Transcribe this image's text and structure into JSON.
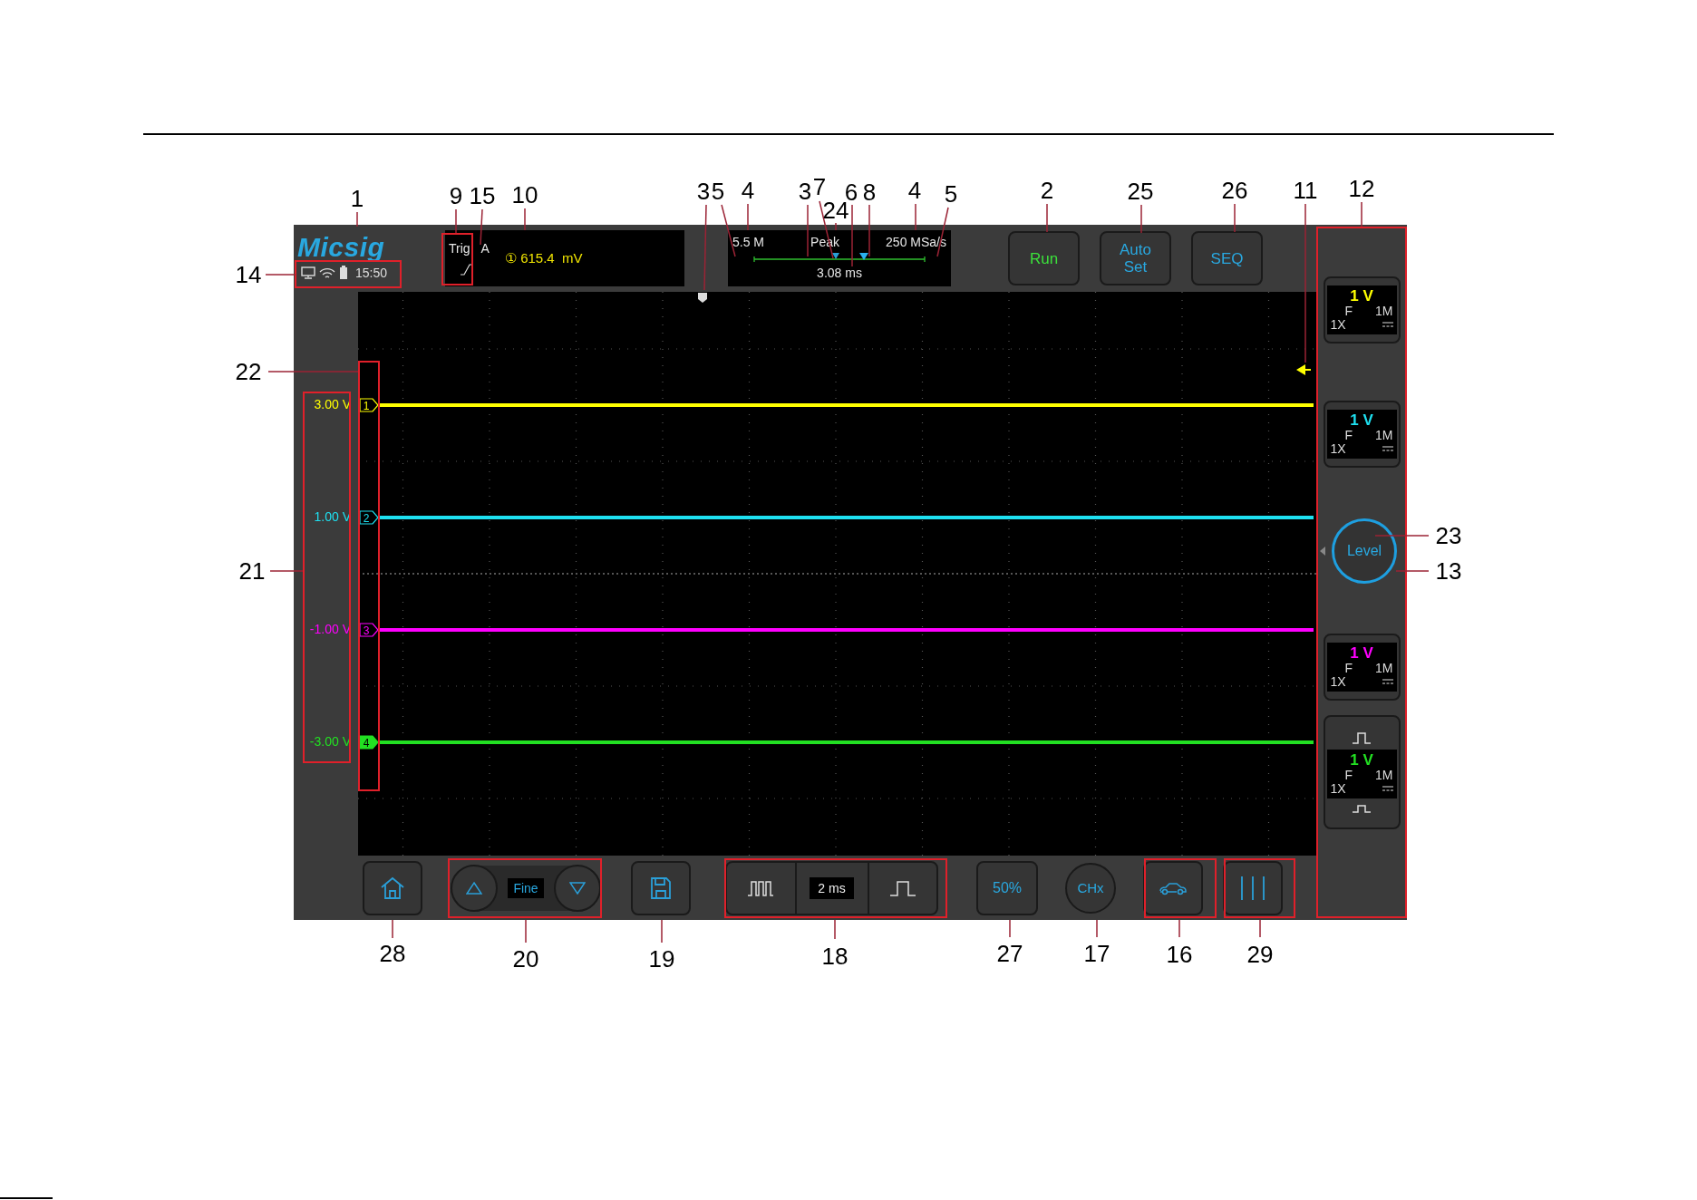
{
  "logo": "Micsig",
  "status": {
    "time": "15:50"
  },
  "trigger": {
    "label": "Trig",
    "source": "A",
    "reading": "① 615.4  mV"
  },
  "acquisition": {
    "memory_depth": "5.5 M",
    "mode": "Peak",
    "sample_rate": "250 MSa/s",
    "time_position": "3.08 ms"
  },
  "top_buttons": [
    {
      "label": "Run",
      "kind": "run"
    },
    {
      "label": "Auto Set",
      "kind": "auto"
    },
    {
      "label": "SEQ",
      "kind": "seq"
    }
  ],
  "channels": [
    {
      "number": "1",
      "offset": "3.00 V",
      "color": "#ffff00",
      "scale": "1 V",
      "bandwidth": "F",
      "impedance": "1M",
      "probe": "1X",
      "selected": false
    },
    {
      "number": "2",
      "offset": "1.00 V",
      "color": "#1ee0f0",
      "scale": "1 V",
      "bandwidth": "F",
      "impedance": "1M",
      "probe": "1X",
      "selected": false
    },
    {
      "number": "3",
      "offset": "-1.00 V",
      "color": "#ff00ff",
      "scale": "1 V",
      "bandwidth": "F",
      "impedance": "1M",
      "probe": "1X",
      "selected": false
    },
    {
      "number": "4",
      "offset": "-3.00 V",
      "color": "#22e022",
      "scale": "1 V",
      "bandwidth": "F",
      "impedance": "1M",
      "probe": "1X",
      "selected": true
    }
  ],
  "level_button": "Level",
  "bottom": {
    "fine": "Fine",
    "timebase": "2 ms",
    "fifty": "50%",
    "chx": "CHx"
  },
  "callouts": [
    {
      "label": "1"
    },
    {
      "label": "14"
    },
    {
      "label": "9"
    },
    {
      "label": "15"
    },
    {
      "label": "10"
    },
    {
      "label": "3"
    },
    {
      "label": "5"
    },
    {
      "label": "4"
    },
    {
      "label": "3"
    },
    {
      "label": "7"
    },
    {
      "label": "24"
    },
    {
      "label": "6"
    },
    {
      "label": "8"
    },
    {
      "label": "4"
    },
    {
      "label": "5"
    },
    {
      "label": "2"
    },
    {
      "label": "25"
    },
    {
      "label": "26"
    },
    {
      "label": "11"
    },
    {
      "label": "12"
    },
    {
      "label": "22"
    },
    {
      "label": "21"
    },
    {
      "label": "23"
    },
    {
      "label": "13"
    },
    {
      "label": "28"
    },
    {
      "label": "20"
    },
    {
      "label": "19"
    },
    {
      "label": "18"
    },
    {
      "label": "27"
    },
    {
      "label": "17"
    },
    {
      "label": "16"
    },
    {
      "label": "29"
    }
  ]
}
